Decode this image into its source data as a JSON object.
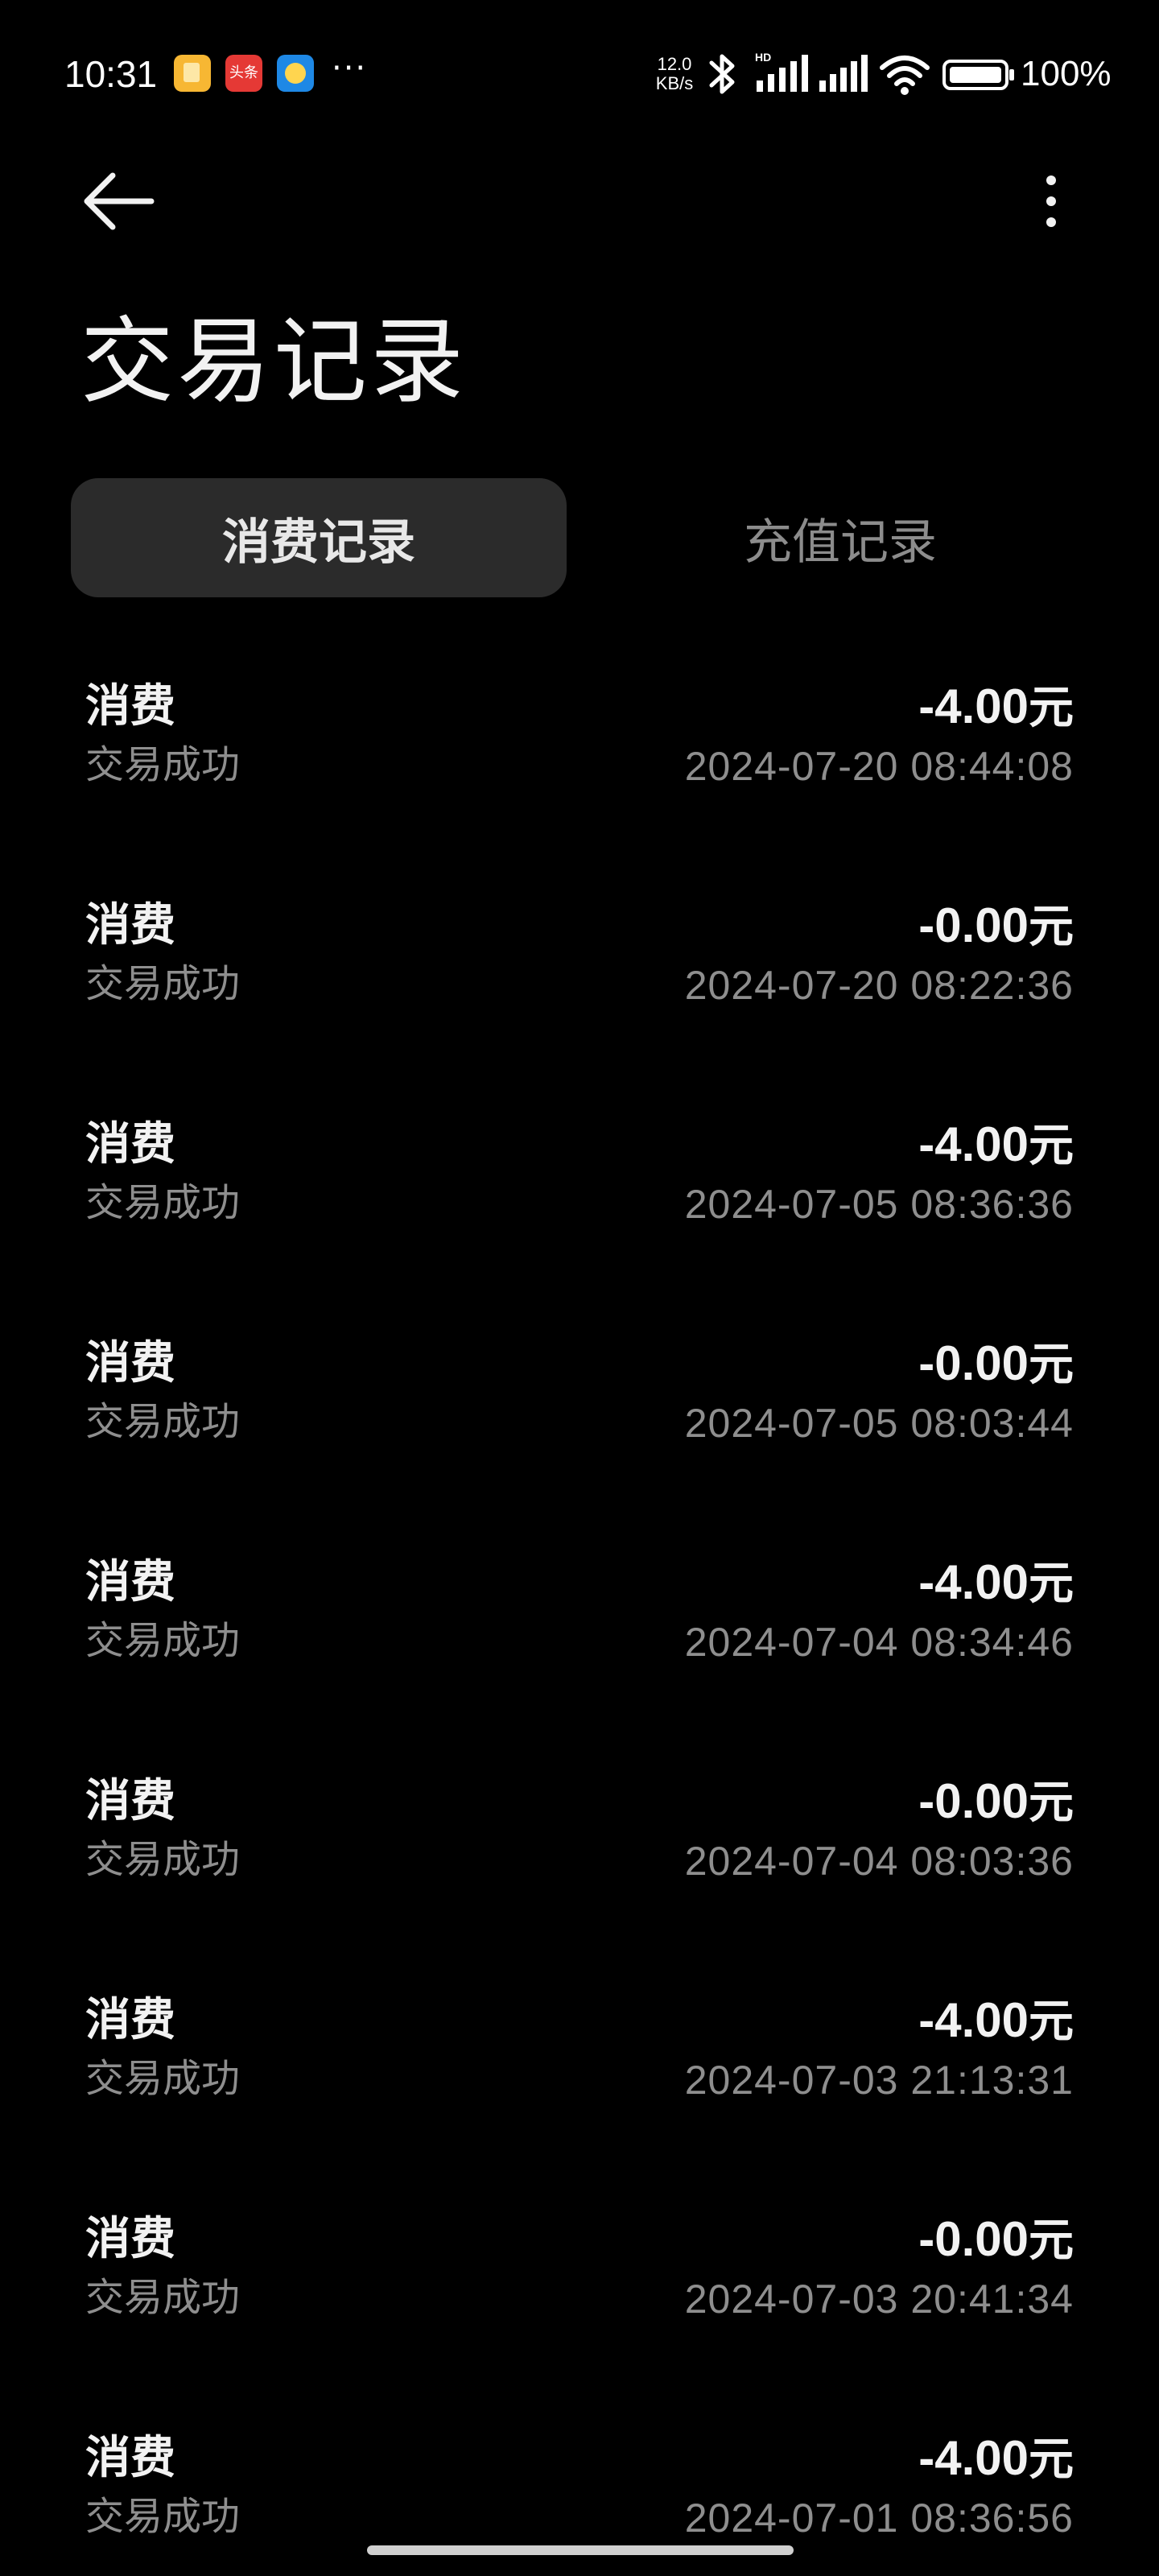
{
  "status_bar": {
    "time": "10:31",
    "notif_app2_label": "头条",
    "more": "···",
    "net_speed_value": "12.0",
    "net_speed_unit": "KB/s",
    "battery_text": "100%"
  },
  "header": {
    "title": "交易记录"
  },
  "tabs": [
    {
      "label": "消费记录",
      "active": true
    },
    {
      "label": "充值记录",
      "active": false
    }
  ],
  "records": [
    {
      "type": "消费",
      "status": "交易成功",
      "amount": "-4.00",
      "unit": "元",
      "time": "2024-07-20 08:44:08"
    },
    {
      "type": "消费",
      "status": "交易成功",
      "amount": "-0.00",
      "unit": "元",
      "time": "2024-07-20 08:22:36"
    },
    {
      "type": "消费",
      "status": "交易成功",
      "amount": "-4.00",
      "unit": "元",
      "time": "2024-07-05 08:36:36"
    },
    {
      "type": "消费",
      "status": "交易成功",
      "amount": "-0.00",
      "unit": "元",
      "time": "2024-07-05 08:03:44"
    },
    {
      "type": "消费",
      "status": "交易成功",
      "amount": "-4.00",
      "unit": "元",
      "time": "2024-07-04 08:34:46"
    },
    {
      "type": "消费",
      "status": "交易成功",
      "amount": "-0.00",
      "unit": "元",
      "time": "2024-07-04 08:03:36"
    },
    {
      "type": "消费",
      "status": "交易成功",
      "amount": "-4.00",
      "unit": "元",
      "time": "2024-07-03 21:13:31"
    },
    {
      "type": "消费",
      "status": "交易成功",
      "amount": "-0.00",
      "unit": "元",
      "time": "2024-07-03 20:41:34"
    },
    {
      "type": "消费",
      "status": "交易成功",
      "amount": "-4.00",
      "unit": "元",
      "time": "2024-07-01 08:36:56"
    }
  ],
  "colors": {
    "background": "#000000",
    "active_tab_bg": "#2b2b2b",
    "primary_text": "#f2f2f2",
    "secondary_text": "#8e8e8e"
  },
  "icons": [
    "back-arrow-icon",
    "more-vertical-icon",
    "bluetooth-icon",
    "signal-icon",
    "wifi-icon",
    "battery-icon"
  ]
}
